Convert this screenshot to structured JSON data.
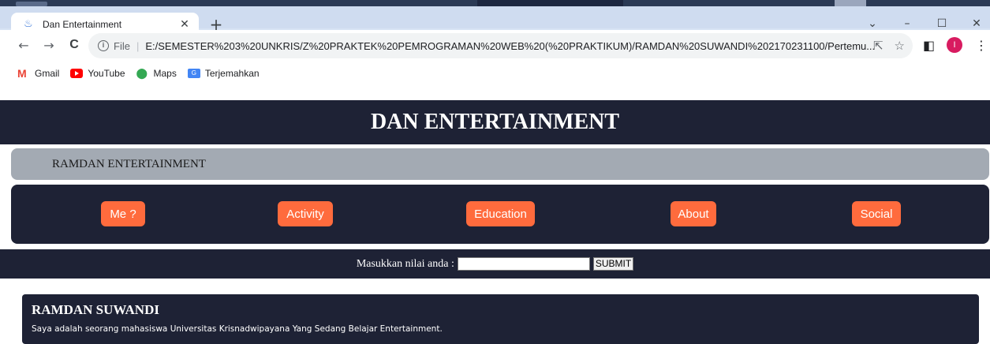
{
  "browser": {
    "tab_title": "Dan Entertainment",
    "tab_close": "✕",
    "new_tab": "+",
    "window_controls": {
      "menu": "⌄",
      "minimize": "–",
      "maximize": "☐",
      "close": "✕"
    },
    "nav": {
      "back": "←",
      "forward": "→",
      "reload": "C"
    },
    "omnibox": {
      "info": "i",
      "scheme_label": "File",
      "url": "E:/SEMESTER%203%20UNKRIS/Z%20PRAKTEK%20PEMROGRAMAN%20WEB%20(%20PRAKTIKUM)/RAMDAN%20SUWANDI%202170231100/Pertemu..."
    },
    "profile_initial": "I",
    "bookmarks": [
      {
        "label": "Gmail",
        "icon": "gmail-icon"
      },
      {
        "label": "YouTube",
        "icon": "youtube-icon"
      },
      {
        "label": "Maps",
        "icon": "maps-icon"
      },
      {
        "label": "Terjemahkan",
        "icon": "translate-icon"
      }
    ]
  },
  "page": {
    "header_title": "DAN ENTERTAINMENT",
    "subtitle": "RAMDAN ENTERTAINMENT",
    "nav_buttons": [
      "Me ?",
      "Activity",
      "Education",
      "About",
      "Social"
    ],
    "form": {
      "label": "Masukkan nilai anda :",
      "input_value": "",
      "submit_label": "SUBMIT"
    },
    "card": {
      "name": "RAMDAN SUWANDI",
      "description": "Saya adalah seorang mahasiswa Universitas Krisnadwipayana Yang Sedang Belajar Entertainment."
    }
  },
  "colors": {
    "dark_navy": "#1e2235",
    "accent_orange": "#ff6b3d",
    "subbar_gray": "#a3aab3"
  }
}
